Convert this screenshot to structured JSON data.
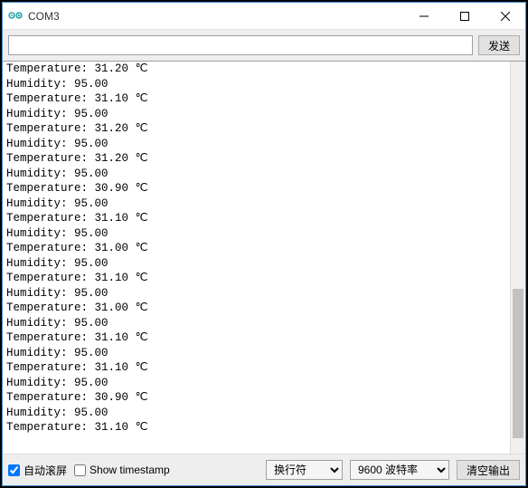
{
  "window": {
    "title": "COM3"
  },
  "toolbar": {
    "input_value": "",
    "send_label": "发送"
  },
  "console": {
    "lines": [
      "Temperature: 31.20 ℃",
      "Humidity: 95.00",
      "Temperature: 31.10 ℃",
      "Humidity: 95.00",
      "Temperature: 31.20 ℃",
      "Humidity: 95.00",
      "Temperature: 31.20 ℃",
      "Humidity: 95.00",
      "Temperature: 30.90 ℃",
      "Humidity: 95.00",
      "Temperature: 31.10 ℃",
      "Humidity: 95.00",
      "Temperature: 31.00 ℃",
      "Humidity: 95.00",
      "Temperature: 31.10 ℃",
      "Humidity: 95.00",
      "Temperature: 31.00 ℃",
      "Humidity: 95.00",
      "Temperature: 31.10 ℃",
      "Humidity: 95.00",
      "Temperature: 31.10 ℃",
      "Humidity: 95.00",
      "Temperature: 30.90 ℃",
      "Humidity: 95.00",
      "Temperature: 31.10 ℃"
    ]
  },
  "bottombar": {
    "autoscroll_label": "自动滚屏",
    "autoscroll_checked": true,
    "timestamp_label": "Show timestamp",
    "timestamp_checked": false,
    "line_ending": "换行符",
    "baud_rate": "9600 波特率",
    "clear_label": "清空输出"
  },
  "colors": {
    "accent": "#00979d"
  }
}
